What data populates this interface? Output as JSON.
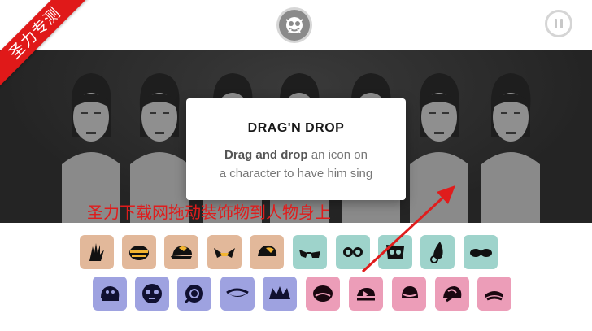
{
  "watermark": {
    "text": "圣力专测"
  },
  "topbar": {
    "logo_icon": "monster-logo-icon",
    "pause_icon": "pause-icon"
  },
  "modal": {
    "title": "DRAG'N DROP",
    "body_bold": "Drag and drop",
    "body_rest_1": " an icon on",
    "body_line_2": "a character to have him sing"
  },
  "annotation": {
    "text": "圣力下载网拖动装饰物到人物身上",
    "color": "#e01c1c"
  },
  "colors": {
    "beats": "#e2b89a",
    "effects": "#9ed3cb",
    "melodies": "#9ea2e0",
    "voices": "#ec9db8",
    "ribbon": "#e01919"
  },
  "icons": {
    "row1": [
      {
        "name": "hand-icon",
        "group": "beats"
      },
      {
        "name": "striped-bee-icon",
        "group": "beats"
      },
      {
        "name": "cap-hat-icon",
        "group": "beats"
      },
      {
        "name": "wing-glasses-icon",
        "group": "beats"
      },
      {
        "name": "beanie-icon",
        "group": "beats"
      },
      {
        "name": "sunglasses-icon",
        "group": "effects"
      },
      {
        "name": "goggles-icon",
        "group": "effects"
      },
      {
        "name": "tribal-mask-icon",
        "group": "effects"
      },
      {
        "name": "drop-icon",
        "group": "effects"
      },
      {
        "name": "shades-icon",
        "group": "effects"
      }
    ],
    "row2": [
      {
        "name": "helmet-icon",
        "group": "melodies"
      },
      {
        "name": "skull-mask-icon",
        "group": "melodies"
      },
      {
        "name": "flower-mask-icon",
        "group": "melodies"
      },
      {
        "name": "fish-hat-icon",
        "group": "melodies"
      },
      {
        "name": "crown-icon",
        "group": "melodies"
      },
      {
        "name": "round-hat-icon",
        "group": "voices"
      },
      {
        "name": "bow-hat-icon",
        "group": "voices"
      },
      {
        "name": "bowler-hat-icon",
        "group": "voices"
      },
      {
        "name": "swirl-hat-icon",
        "group": "voices"
      },
      {
        "name": "visor-hat-icon",
        "group": "voices"
      }
    ]
  }
}
